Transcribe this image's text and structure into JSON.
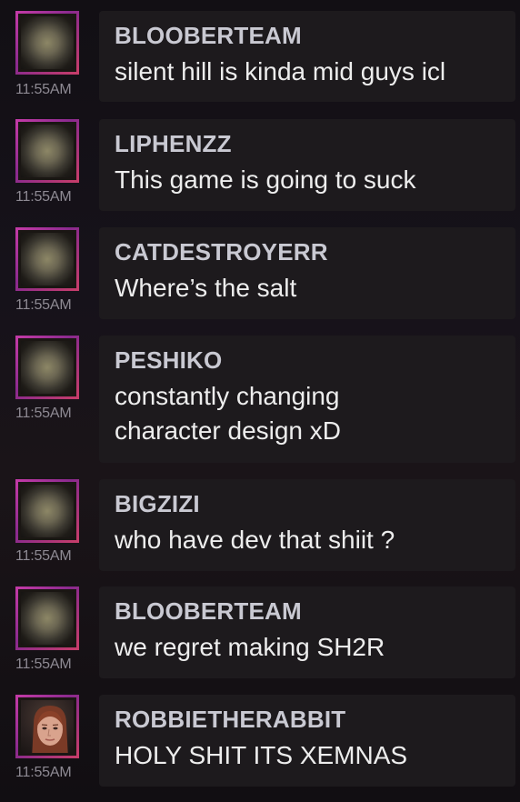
{
  "messages": [
    {
      "user": "BLOOBERTEAM",
      "text": "silent hill is kinda mid guys icl",
      "time": "11:55AM",
      "avatar": "blurred-placeholder-avatar"
    },
    {
      "user": "LIPHENZZ",
      "text": "This game is going to suck",
      "time": "11:55AM",
      "avatar": "blurred-placeholder-avatar"
    },
    {
      "user": "CATDESTROYERR",
      "text": "Where’s the salt",
      "time": "11:55AM",
      "avatar": "blurred-placeholder-avatar"
    },
    {
      "user": "PESHIKO",
      "text": "constantly changing character design xD",
      "time": "11:55AM",
      "avatar": "blurred-placeholder-avatar"
    },
    {
      "user": "BIGZIZI",
      "text": "who have dev that shiit ?",
      "time": "11:55AM",
      "avatar": "blurred-placeholder-avatar"
    },
    {
      "user": "BLOOBERTEAM",
      "text": "we regret making SH2R",
      "time": "11:55AM",
      "avatar": "blurred-placeholder-avatar"
    },
    {
      "user": "ROBBIETHERABBIT",
      "text": "HOLY SHIT ITS XEMNAS",
      "time": "11:55AM",
      "avatar": "character-face-avatar"
    }
  ],
  "colors": {
    "avatar_frame": "#b2359e",
    "bubble": "#1e1b1e",
    "username": "#c9c9d2",
    "message_text": "#ededed",
    "timestamp": "#8e8a93"
  }
}
